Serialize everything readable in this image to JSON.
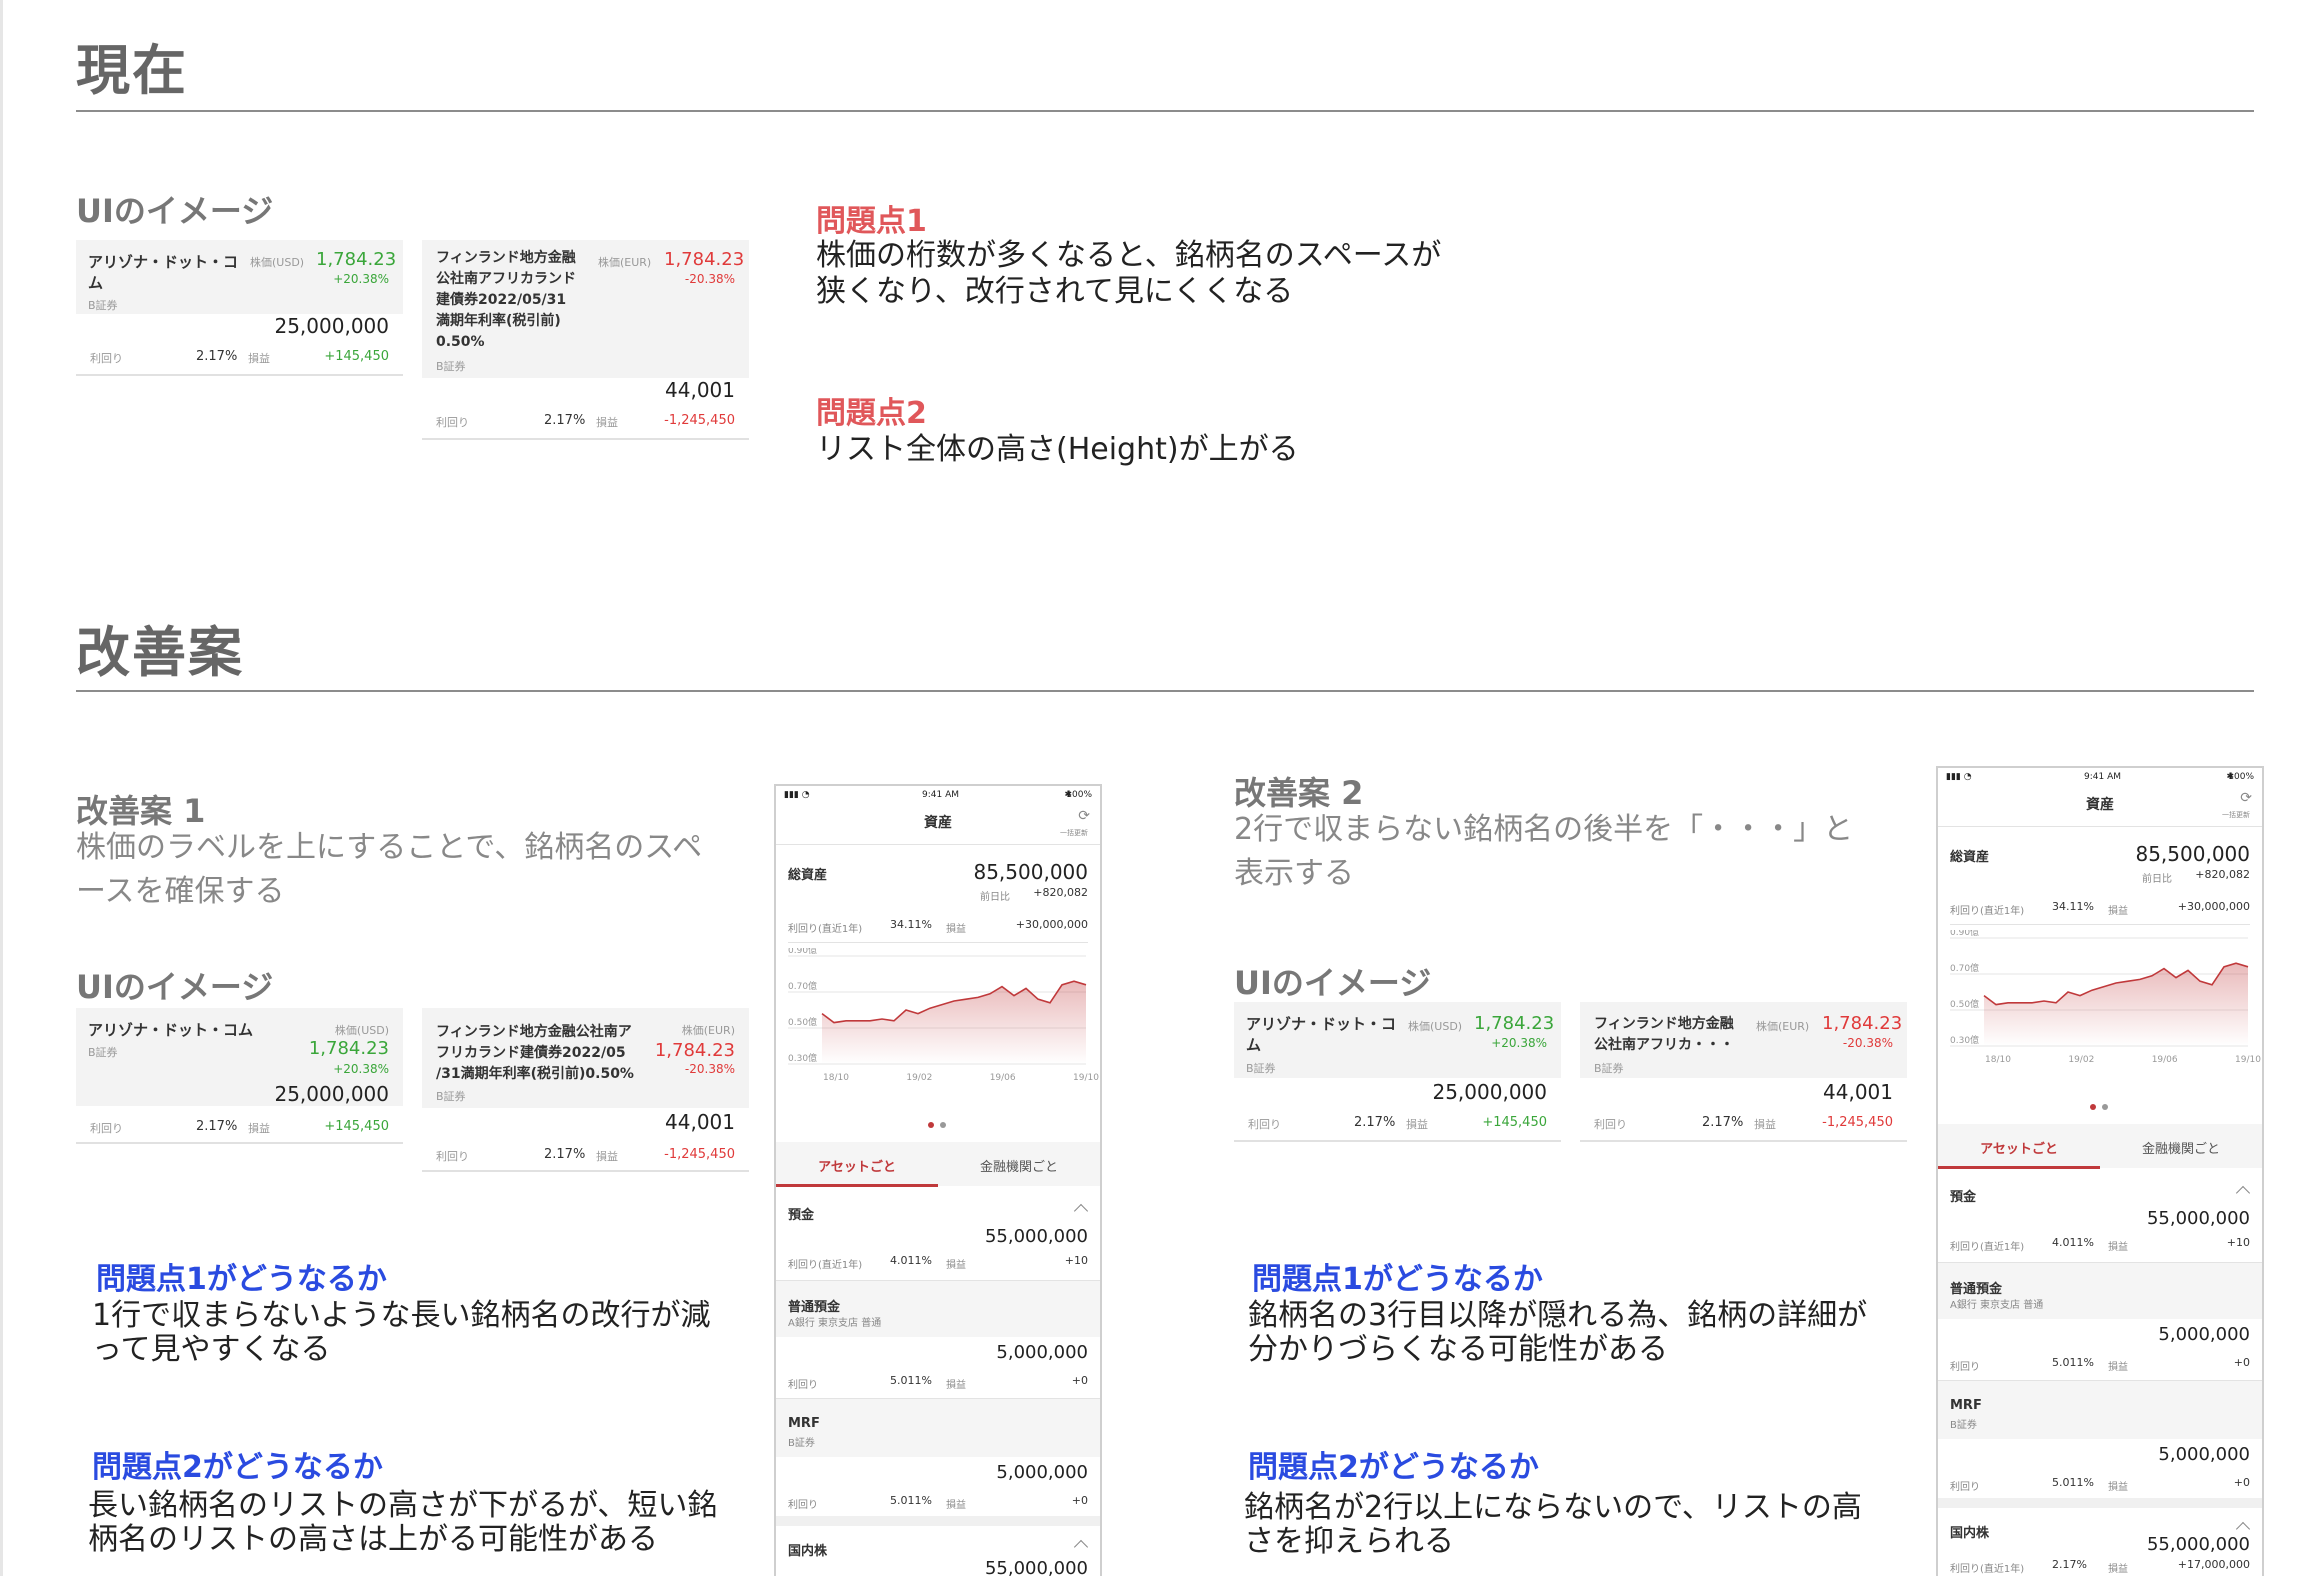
{
  "current": {
    "title": "現在",
    "ui_heading": "UIのイメージ",
    "problem1_title": "問題点1",
    "problem1_lines": [
      "株価の桁数が多くなると、銘柄名のスペースが",
      "狭くなり、改行されて見にくくなる"
    ],
    "problem2_title": "問題点2",
    "problem2_line": "リスト全体の高さ(Height)が上がる"
  },
  "improve": {
    "title": "改善案",
    "ui_heading": "UIのイメージ",
    "plan1": {
      "title": "改善案 1",
      "desc_lines": [
        "株価のラベルを上にすることで、銘柄名のスペ",
        "ースを確保する"
      ],
      "q1_title": "問題点1がどうなるか",
      "q1_lines": [
        "1行で収まらないような長い銘柄名の改行が減",
        "って見やすくなる"
      ],
      "q2_title": "問題点2がどうなるか",
      "q2_lines": [
        "長い銘柄名のリストの高さが下がるが、短い銘",
        "柄名のリストの高さは上がる可能性がある"
      ]
    },
    "plan2": {
      "title": "改善案 2",
      "desc_lines": [
        "2行で収まらない銘柄名の後半を「・・・」と",
        "表示する"
      ],
      "q1_title": "問題点1がどうなるか",
      "q1_lines": [
        "銘柄名の3行目以降が隠れる為、銘柄の詳細が",
        "分かりづらくなる可能性がある"
      ],
      "q2_title": "問題点2がどうなるか",
      "q2_lines": [
        "銘柄名が2行以上にならないので、リストの高",
        "さを抑えられる"
      ]
    }
  },
  "cards": {
    "arizona": {
      "name": "アリゾナ・ドット・コム",
      "name_l1": "アリゾナ・ドット・コ",
      "name_l2": "ム",
      "broker": "B証券",
      "price_label": "株価(USD)",
      "price": "1,784.23",
      "pct": "+20.38%",
      "amount": "25,000,000",
      "yield_label": "利回り",
      "yield": "2.17%",
      "pnl_label": "損益",
      "pnl": "+145,450"
    },
    "finland": {
      "name_current": [
        "フィンランド地方金融",
        "公社南アフリカランド",
        "建債券2022/05/31",
        "満期年利率(税引前)",
        "0.50%"
      ],
      "name_plan1": [
        "フィンランド地方金融公社南ア",
        "フリカランド建債券2022/05",
        "/31満期年利率(税引前)0.50%"
      ],
      "name_plan2": [
        "フィンランド地方金融",
        "公社南アフリカ・・・"
      ],
      "broker": "B証券",
      "price_label": "株価(EUR)",
      "price": "1,784.23",
      "pct": "-20.38%",
      "amount": "44,001",
      "yield_label": "利回り",
      "yield": "2.17%",
      "pnl_label": "損益",
      "pnl": "-1,245,450"
    }
  },
  "phone": {
    "time": "9:41 AM",
    "battery": "100%",
    "title": "資産",
    "refresh": "一括更新",
    "total_label": "総資産",
    "total": "85,500,000",
    "prev_label": "前日比",
    "prev": "+820,082",
    "yield_label": "利回り(直近1年)",
    "yield": "34.11%",
    "pnl_label": "損益",
    "pnl": "+30,000,000",
    "tab_asset": "アセットごと",
    "tab_inst": "金融機関ごと",
    "deposit_label": "預金",
    "deposit": "55,000,000",
    "deposit_yield": "4.011%",
    "deposit_pnl": "+10",
    "savings_label": "普通預金",
    "savings_sub": "A銀行 東京支店 普通",
    "savings": "5,000,000",
    "row_yield_label": "利回り",
    "row_yield": "5.011%",
    "row_pnl": "+0",
    "mrf_label": "MRF",
    "mrf_sub": "B証券",
    "mrf": "5,000,000",
    "domestic_label": "国内株",
    "domestic": "55,000,000",
    "domestic_yield": "2.17%",
    "domestic_pnl": "+17,000,000"
  },
  "chart_data": {
    "type": "area",
    "x": [
      "18/10",
      "19/02",
      "19/06",
      "19/10"
    ],
    "y_ticks": [
      "0.90億",
      "0.70億",
      "0.50億",
      "0.30億"
    ],
    "ylim": [
      0.3,
      0.9
    ],
    "values": [
      0.58,
      0.53,
      0.54,
      0.54,
      0.54,
      0.55,
      0.54,
      0.6,
      0.58,
      0.61,
      0.63,
      0.65,
      0.66,
      0.67,
      0.69,
      0.73,
      0.68,
      0.72,
      0.66,
      0.64,
      0.74,
      0.76,
      0.74
    ],
    "line_color": "#c0393b"
  }
}
